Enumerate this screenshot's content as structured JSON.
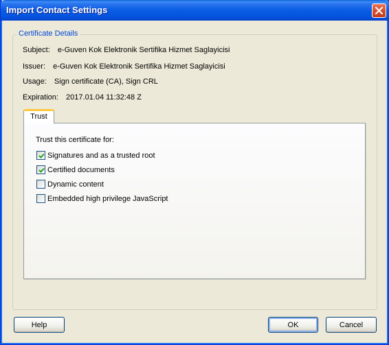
{
  "window": {
    "title": "Import Contact Settings"
  },
  "group": {
    "legend": "Certificate Details"
  },
  "details": {
    "subject_label": "Subject:",
    "subject_value": "e-Guven Kok Elektronik Sertifika Hizmet Saglayicisi",
    "issuer_label": "Issuer:",
    "issuer_value": "e-Guven Kok Elektronik Sertifika Hizmet Saglayicisi",
    "usage_label": "Usage:",
    "usage_value": "Sign certificate (CA), Sign CRL",
    "expiration_label": "Expiration:",
    "expiration_value": "2017.01.04 11:32:48 Z"
  },
  "tabs": {
    "trust_label": "Trust"
  },
  "trust": {
    "heading": "Trust this certificate for:",
    "options": [
      {
        "label": "Signatures and as a trusted root",
        "checked": true
      },
      {
        "label": "Certified documents",
        "checked": true
      },
      {
        "label": "Dynamic content",
        "checked": false
      },
      {
        "label": "Embedded high privilege JavaScript",
        "checked": false
      }
    ]
  },
  "buttons": {
    "help": "Help",
    "ok": "OK",
    "cancel": "Cancel"
  },
  "icons": {
    "close": "close-icon",
    "check": "checkmark-icon"
  },
  "colors": {
    "legend": "#0046d5",
    "tab_highlight": "#ffc83c",
    "check": "#21a121"
  }
}
